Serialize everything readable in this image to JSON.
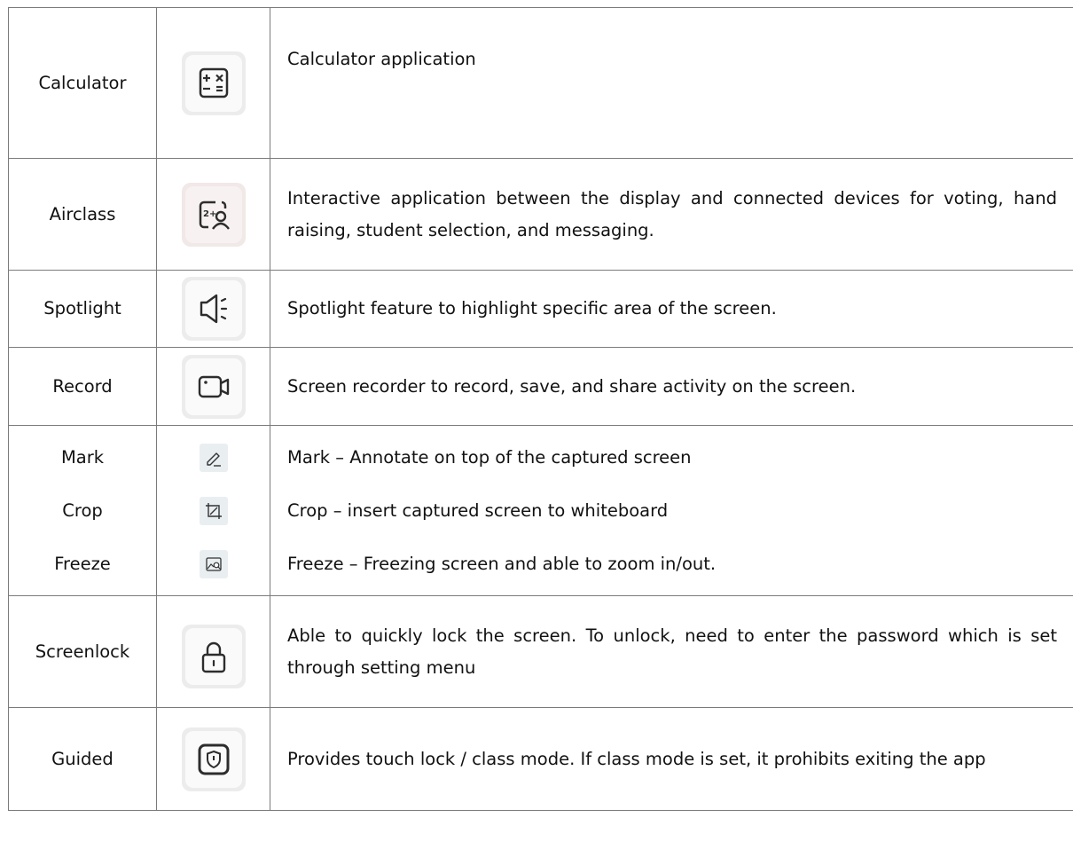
{
  "rows": [
    {
      "name": "Calculator",
      "icon": "calculator-icon",
      "description": "Calculator application"
    },
    {
      "name": "Airclass",
      "icon": "airclass-icon",
      "description": "Interactive application between the display and connected devices for voting, hand raising, student selection, and messaging."
    },
    {
      "name": "Spotlight",
      "icon": "spotlight-icon",
      "description": "Spotlight feature to highlight specific area of the screen."
    },
    {
      "name": "Record",
      "icon": "video-camera-icon",
      "description": "Screen recorder to record, save, and share activity on the screen."
    },
    {
      "name": "Screenlock",
      "icon": "padlock-icon",
      "description": "Able to quickly lock the screen. To unlock, need to enter the password which is set through setting menu"
    },
    {
      "name": "Guided",
      "icon": "shield-icon",
      "description": "Provides touch lock / class mode. If class mode is set, it prohibits exiting the app"
    }
  ],
  "capture": [
    {
      "name": "Mark",
      "icon": "pen-icon",
      "description": "Mark – Annotate on top of the captured screen"
    },
    {
      "name": "Crop",
      "icon": "crop-icon",
      "description": "Crop – insert captured screen to whiteboard"
    },
    {
      "name": "Freeze",
      "icon": "freeze-image-icon",
      "description": "Freeze – Freezing screen and able to zoom in/out."
    }
  ]
}
